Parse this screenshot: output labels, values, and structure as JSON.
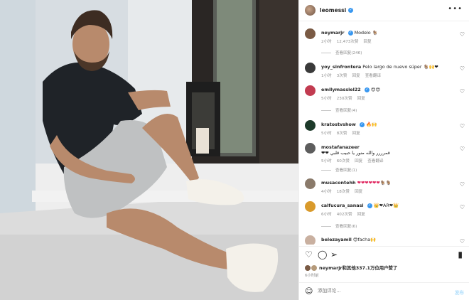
{
  "header": {
    "username": "leomessi",
    "more": "•••",
    "verified": "✓"
  },
  "comments": [
    {
      "user": "neymarjr",
      "verified": true,
      "text": "Modelo 🐐",
      "time": "2小时",
      "likes": "12,473次赞",
      "reply": "回复",
      "view_replies": "查看回复(246)",
      "avatar_color": "#7a5a44"
    },
    {
      "user": "yoy_sinfrontera",
      "verified": false,
      "text": "Pelo largo de nuevo súper 🐐🙌❤",
      "time": "1小时",
      "likes": "3次赞",
      "reply": "回复",
      "translate": "查看翻译",
      "avatar_color": "#3a3a3a"
    },
    {
      "user": "emilymassiel22",
      "verified": true,
      "text": "😍😍",
      "time": "5小时",
      "likes": "230次赞",
      "reply": "回复",
      "view_replies": "查看回复(4)",
      "avatar_color": "#c23b50"
    },
    {
      "user": "kratostvshow",
      "verified": true,
      "text": "🔥🙌",
      "time": "5小时",
      "likes": "8次赞",
      "reply": "回复",
      "avatar_color": "#1d3a2a"
    },
    {
      "user": "mostafanazeer",
      "verified": false,
      "text": "قمرررر والله منور يا حبيب قلبي ❤❤",
      "time": "5小时",
      "likes": "60次赞",
      "reply": "回复",
      "translate": "查看翻译",
      "view_replies": "查看回复(1)",
      "avatar_color": "#5d5d5d"
    },
    {
      "user": "musacontehh",
      "verified": false,
      "text": "❤❤❤❤❤❤🐐🐐",
      "time": "4小时",
      "likes": "18次赞",
      "reply": "回复",
      "avatar_color": "#8a7a6a"
    },
    {
      "user": "calfucura_sanasi",
      "verified": true,
      "text": "👑❤AR❤👑",
      "time": "6小时",
      "likes": "402次赞",
      "reply": "回复",
      "view_replies": "查看回复(6)",
      "avatar_color": "#d99a2b"
    },
    {
      "user": "belezayamil",
      "verified": false,
      "text": "😍facha🙌",
      "avatar_color": "#c9b0a0"
    }
  ],
  "actions": {
    "like_icon": "heart-outline-icon",
    "comment_icon": "comment-icon",
    "share_icon": "send-icon",
    "save_icon": "bookmark-icon"
  },
  "likes": {
    "users": "neymarjr和其他",
    "count": "337.1万位用户赞了"
  },
  "post_time": "6小时前",
  "add_comment": {
    "placeholder": "添加评论...",
    "post_label": "发布"
  },
  "colors": {
    "verified": "#3897f0",
    "meta": "#8e8e8e",
    "border": "#efefef"
  }
}
